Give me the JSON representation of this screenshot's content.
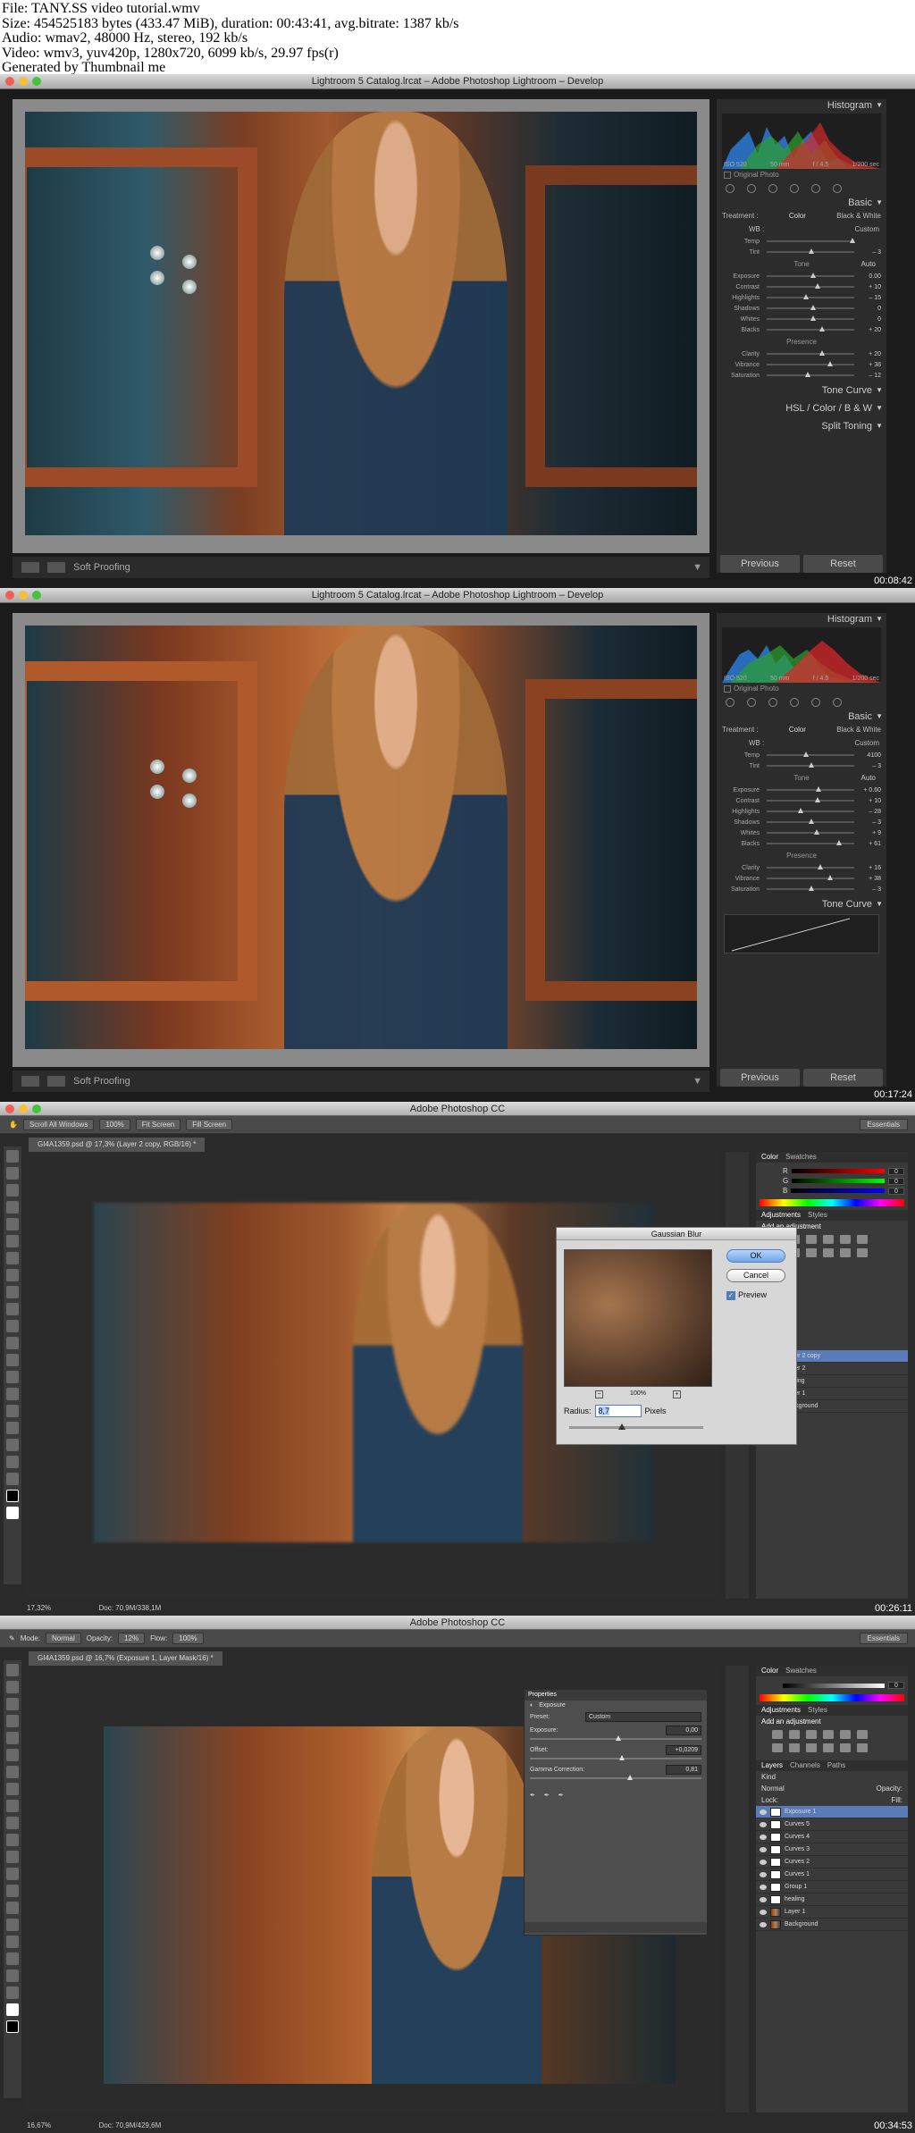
{
  "header": {
    "file": "File: TANY.SS video tutorial.wmv",
    "size": "Size: 454525183 bytes (433.47 MiB), duration: 00:43:41, avg.bitrate: 1387 kb/s",
    "audio": "Audio: wmav2, 48000 Hz, stereo, 192 kb/s",
    "video": "Video: wmv3, yuv420p, 1280x720, 6099 kb/s, 29.97 fps(r)",
    "generated": "Generated by Thumbnail me"
  },
  "lr1": {
    "title": "Lightroom 5 Catalog.lrcat – Adobe Photoshop Lightroom – Develop",
    "timestamp": "00:08:42",
    "histogram": "Histogram",
    "meta": [
      "ISO 520",
      "50 mm",
      "f / 4.5",
      "1/200 sec"
    ],
    "original_photo": "Original Photo",
    "basic": "Basic",
    "treatment": "Treatment :",
    "color": "Color",
    "bw": "Black & White",
    "wb_label": "WB :",
    "wb_value": "Custom",
    "tone": "Tone",
    "auto": "Auto",
    "presence": "Presence",
    "sliders_wb": [
      {
        "label": "Temp",
        "value": "",
        "pos": 0.95
      },
      {
        "label": "Tint",
        "value": "– 3",
        "pos": 0.48
      }
    ],
    "sliders_tone": [
      {
        "label": "Exposure",
        "value": "0.00",
        "pos": 0.5
      },
      {
        "label": "Contrast",
        "value": "+ 10",
        "pos": 0.55
      },
      {
        "label": "Highlights",
        "value": "– 15",
        "pos": 0.42
      },
      {
        "label": "Shadows",
        "value": "0",
        "pos": 0.5
      },
      {
        "label": "Whites",
        "value": "0",
        "pos": 0.5
      },
      {
        "label": "Blacks",
        "value": "+ 20",
        "pos": 0.6
      }
    ],
    "sliders_presence": [
      {
        "label": "Clarity",
        "value": "+ 20",
        "pos": 0.6
      },
      {
        "label": "Vibrance",
        "value": "+ 38",
        "pos": 0.69
      },
      {
        "label": "Saturation",
        "value": "– 12",
        "pos": 0.44
      }
    ],
    "tone_curve": "Tone Curve",
    "hsl": "HSL  /  Color  /  B & W",
    "split_toning": "Split Toning",
    "soft_proofing": "Soft Proofing",
    "previous": "Previous",
    "reset": "Reset"
  },
  "lr2": {
    "title": "Lightroom 5 Catalog.lrcat – Adobe Photoshop Lightroom – Develop",
    "timestamp": "00:17:24",
    "histogram": "Histogram",
    "meta": [
      "ISO 520",
      "50 mm",
      "f / 4.5",
      "1/200 sec"
    ],
    "original_photo": "Original Photo",
    "basic": "Basic",
    "treatment": "Treatment :",
    "color": "Color",
    "bw": "Black & White",
    "wb_label": "WB :",
    "wb_value": "Custom",
    "tone": "Tone",
    "auto": "Auto",
    "presence": "Presence",
    "sliders_wb": [
      {
        "label": "Temp",
        "value": "4100",
        "pos": 0.42
      },
      {
        "label": "Tint",
        "value": "– 3",
        "pos": 0.48
      }
    ],
    "sliders_tone": [
      {
        "label": "Exposure",
        "value": "+ 0.60",
        "pos": 0.56
      },
      {
        "label": "Contrast",
        "value": "+ 10",
        "pos": 0.55
      },
      {
        "label": "Highlights",
        "value": "– 28",
        "pos": 0.36
      },
      {
        "label": "Shadows",
        "value": "– 3",
        "pos": 0.48
      },
      {
        "label": "Whites",
        "value": "+ 9",
        "pos": 0.54
      },
      {
        "label": "Blacks",
        "value": "+ 61",
        "pos": 0.8
      }
    ],
    "sliders_presence": [
      {
        "label": "Clarity",
        "value": "+ 16",
        "pos": 0.58
      },
      {
        "label": "Vibrance",
        "value": "+ 38",
        "pos": 0.69
      },
      {
        "label": "Saturation",
        "value": "– 3",
        "pos": 0.48
      }
    ],
    "tone_curve": "Tone Curve",
    "soft_proofing": "Soft Proofing",
    "previous": "Previous",
    "reset": "Reset"
  },
  "ps1": {
    "title": "Adobe Photoshop CC",
    "timestamp": "00:26:11",
    "opts": [
      "Scroll All Windows",
      "100%",
      "Fit Screen",
      "Fill Screen"
    ],
    "essentials": "Essentials",
    "doc_tab": "GI4A1359.psd @ 17,3% (Layer 2 copy, RGB/16) *",
    "status_zoom": "17,32%",
    "status_doc": "Doc: 70,9M/338,1M",
    "color_tab": "Color",
    "swatches_tab": "Swatches",
    "rgb": [
      {
        "ch": "R",
        "v": "0"
      },
      {
        "ch": "G",
        "v": "0"
      },
      {
        "ch": "B",
        "v": "0"
      }
    ],
    "adjustments": "Adjustments",
    "styles": "Styles",
    "add_adjustment": "Add an adjustment",
    "layers": [
      {
        "name": "Layer 2 copy",
        "sel": true
      },
      {
        "name": "Layer 2",
        "sel": false
      },
      {
        "name": "healing",
        "sel": false
      },
      {
        "name": "Layer 1",
        "sel": false
      },
      {
        "name": "Background",
        "sel": false
      }
    ],
    "dialog": {
      "title": "Gaussian Blur",
      "ok": "OK",
      "cancel": "Cancel",
      "preview": "Preview",
      "zoom": "100%",
      "minus": "−",
      "plus": "+",
      "radius_label": "Radius:",
      "radius_value": "8,7",
      "unit": "Pixels"
    }
  },
  "ps2": {
    "title": "Adobe Photoshop CC",
    "timestamp": "00:34:53",
    "mode_label": "Mode:",
    "mode_value": "Normal",
    "opacity_label": "Opacity:",
    "opacity_value": "12%",
    "flow_label": "Flow:",
    "flow_value": "100%",
    "essentials": "Essentials",
    "doc_tab": "GI4A1359.psd @ 16,7% (Exposure 1, Layer Mask/16) *",
    "status_zoom": "16,67%",
    "status_doc": "Doc: 70,9M/429,6M",
    "color_tab": "Color",
    "swatches_tab": "Swatches",
    "slider_value": "0",
    "adjustments": "Adjustments",
    "styles": "Styles",
    "add_adjustment": "Add an adjustment",
    "layers_tab": "Layers",
    "channels_tab": "Channels",
    "paths_tab": "Paths",
    "kind": "Kind",
    "blend": "Normal",
    "opacity_short": "Opacity:",
    "lock": "Lock:",
    "fill": "Fill:",
    "layers": [
      {
        "name": "Exposure 1",
        "sel": true,
        "img": false
      },
      {
        "name": "Curves 5",
        "sel": false,
        "img": false
      },
      {
        "name": "Curves 4",
        "sel": false,
        "img": false
      },
      {
        "name": "Curves 3",
        "sel": false,
        "img": false
      },
      {
        "name": "Curves 2",
        "sel": false,
        "img": false
      },
      {
        "name": "Curves 1",
        "sel": false,
        "img": false
      },
      {
        "name": "Group 1",
        "sel": false,
        "img": false
      },
      {
        "name": "healing",
        "sel": false,
        "img": false
      },
      {
        "name": "Layer 1",
        "sel": false,
        "img": true
      },
      {
        "name": "Background",
        "sel": false,
        "img": true
      }
    ],
    "properties": {
      "tab": "Properties",
      "title": "Exposure",
      "preset_label": "Preset:",
      "preset_value": "Custom",
      "exposure_label": "Exposure:",
      "exposure_value": "0,00",
      "offset_label": "Offset:",
      "offset_value": "+0,0209",
      "gamma_label": "Gamma Correction:",
      "gamma_value": "0,81"
    }
  }
}
